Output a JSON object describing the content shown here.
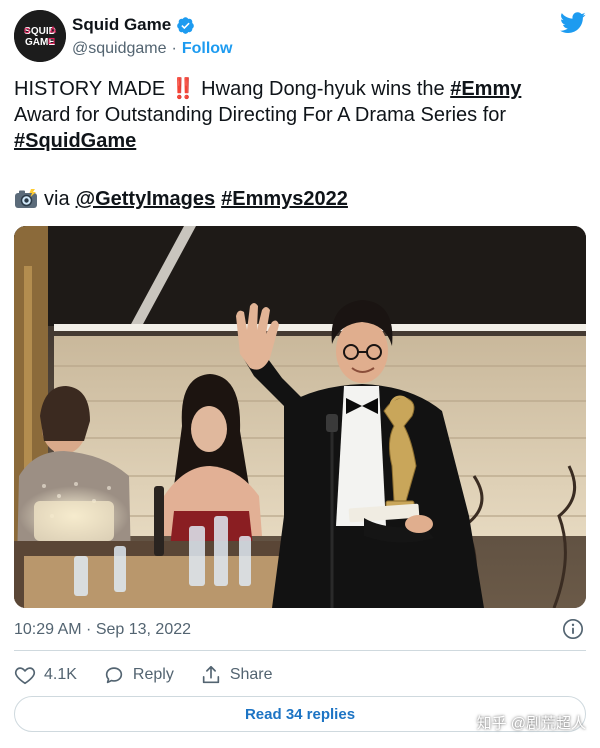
{
  "account": {
    "display_name": "Squid Game",
    "handle": "@squidgame",
    "separator": "·",
    "follow_label": "Follow",
    "avatar_text_top": "SQUID",
    "avatar_text_bottom": "GAME",
    "verified": true
  },
  "tweet": {
    "line1_prefix": "HISTORY MADE ",
    "emphasis": "‼️",
    "line1_middle": " Hwang Dong-hyuk wins the ",
    "hashtag_emmy": "#Emmy",
    "line2": "Award for Outstanding Directing For A Drama Series for",
    "hashtag_squidgame": "#SquidGame",
    "credit_via": "via",
    "mention_getty": "@GettyImages",
    "hashtag_emmys2022": "#Emmys2022"
  },
  "meta": {
    "timestamp": "10:29 AM · Sep 13, 2022"
  },
  "actions": {
    "like_count": "4.1K",
    "reply_label": "Reply",
    "share_label": "Share",
    "read_replies_label": "Read 34 replies"
  },
  "watermark": {
    "text": "知乎 @剧荒超人"
  },
  "colors": {
    "brand_blue": "#1d9bf0",
    "link_blue": "#1d74c4",
    "text_primary": "#0f1419",
    "text_secondary": "#536471",
    "border": "#cfd9de"
  }
}
